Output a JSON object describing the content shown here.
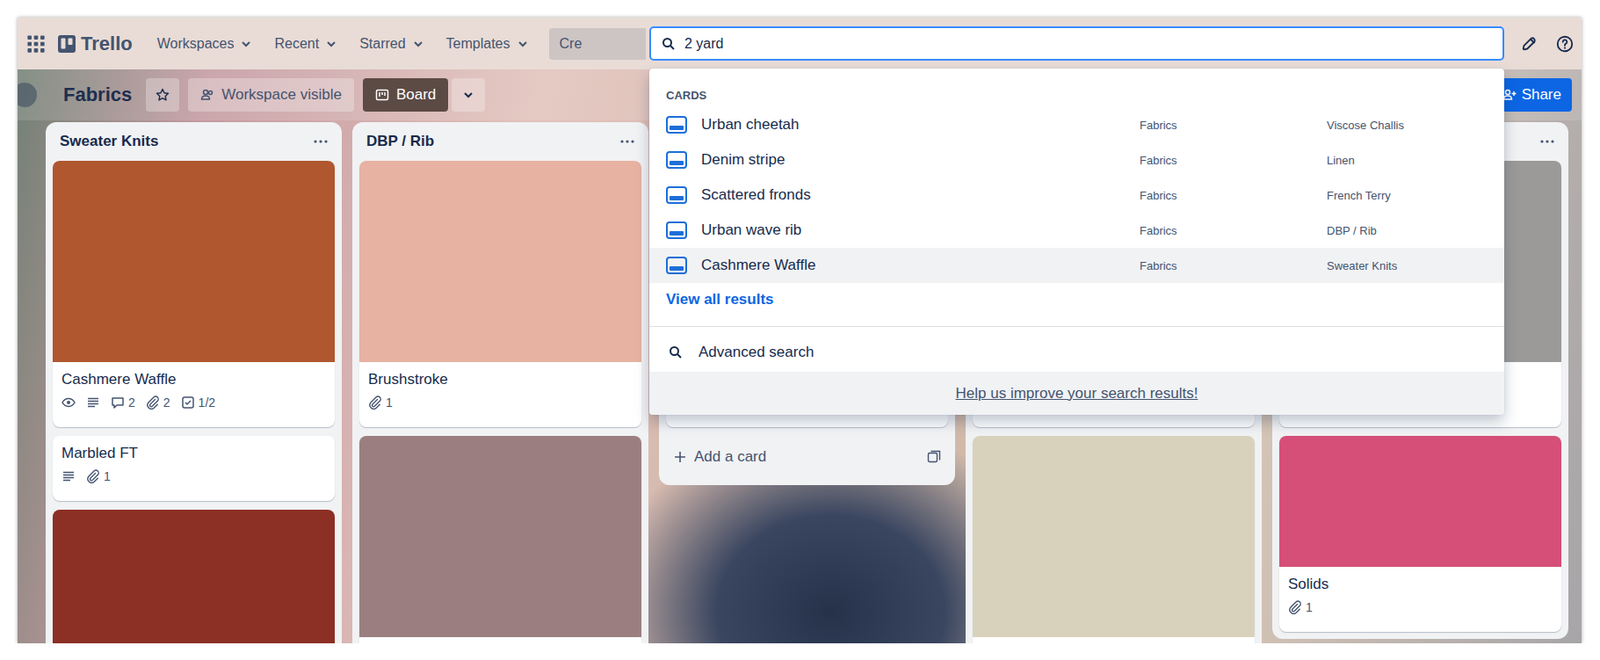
{
  "nav": {
    "logo": "Trello",
    "menus": [
      {
        "label": "Workspaces"
      },
      {
        "label": "Recent"
      },
      {
        "label": "Starred"
      },
      {
        "label": "Templates"
      }
    ],
    "create": "Cre"
  },
  "search": {
    "value": "2 yard"
  },
  "board": {
    "title": "Fabrics",
    "starred": false,
    "visibility": "Workspace visible",
    "view": "Board",
    "share": "Share"
  },
  "lists": [
    {
      "title": "Sweater Knits",
      "cards": [
        {
          "title": "Cashmere Waffle",
          "cover": true,
          "color": "#b0572f",
          "badges": [
            {
              "kind": "watch"
            },
            {
              "kind": "description"
            },
            {
              "kind": "comments",
              "text": "2"
            },
            {
              "kind": "attachments",
              "text": "2"
            },
            {
              "kind": "checklist",
              "text": "1/2"
            }
          ]
        },
        {
          "title": "Marbled FT",
          "cover": false,
          "badges": [
            {
              "kind": "description"
            },
            {
              "kind": "attachments",
              "text": "1"
            }
          ]
        },
        {
          "cover": true,
          "color": "#8c2f24",
          "badges": []
        }
      ]
    },
    {
      "title": "DBP / Rib",
      "cards": [
        {
          "title": "Brushstroke",
          "cover": true,
          "color": "#e7b2a2",
          "badges": [
            {
              "kind": "attachments",
              "text": "1"
            }
          ]
        },
        {
          "cover": true,
          "color": "#9b7f80",
          "badges": []
        }
      ]
    },
    {
      "cards": [
        {
          "cover": true,
          "color": "#c8b49a",
          "badges": []
        }
      ],
      "add_card": "Add a card"
    },
    {
      "cards": [
        {
          "cover": true,
          "color": "#b9a48e",
          "badges": []
        },
        {
          "cover": true,
          "color": "#d8d2bd",
          "badges": []
        }
      ]
    },
    {
      "cards": [
        {
          "cover": true,
          "color": "#9c9a98",
          "badges": []
        },
        {
          "title": "Solids",
          "cover": true,
          "color": "#d54f78",
          "badges": [
            {
              "kind": "attachments",
              "text": "1"
            }
          ]
        }
      ]
    }
  ],
  "search_results": {
    "section": "CARDS",
    "cards": [
      {
        "title": "Urban cheetah",
        "board": "Fabrics",
        "list": "Viscose Challis",
        "selected": false
      },
      {
        "title": "Denim stripe",
        "board": "Fabrics",
        "list": "Linen",
        "selected": false
      },
      {
        "title": "Scattered fronds",
        "board": "Fabrics",
        "list": "French Terry",
        "selected": false
      },
      {
        "title": "Urban wave rib",
        "board": "Fabrics",
        "list": "DBP / Rib",
        "selected": false
      },
      {
        "title": "Cashmere Waffle",
        "board": "Fabrics",
        "list": "Sweater Knits",
        "selected": true
      }
    ],
    "view_all": "View all results",
    "advanced": "Advanced search",
    "feedback": "Help us improve your search results!"
  }
}
